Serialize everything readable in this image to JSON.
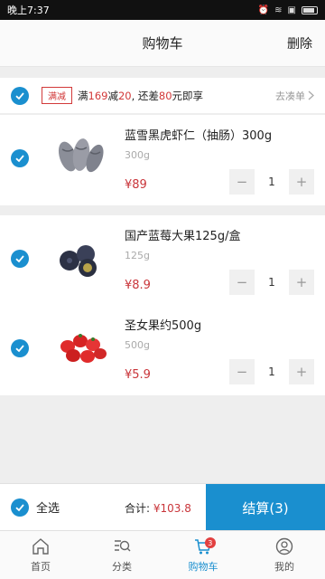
{
  "status_bar": {
    "time": "晚上7:37"
  },
  "header": {
    "title": "购物车",
    "delete_label": "删除"
  },
  "promo": {
    "tag": "满减",
    "text_prefix": "满",
    "threshold": "169",
    "text_mid1": "减",
    "discount": "20",
    "text_mid2": ", 还差",
    "remaining": "80",
    "text_suffix": "元即享",
    "more_label": "去凑单"
  },
  "items": [
    {
      "name": "蓝雪黑虎虾仁（抽肠）300g",
      "weight": "300g",
      "price": "¥89",
      "qty": "1"
    },
    {
      "name": "国产蓝莓大果125g/盒",
      "weight": "125g",
      "price": "¥8.9",
      "qty": "1"
    },
    {
      "name": "圣女果约500g",
      "weight": "500g",
      "price": "¥5.9",
      "qty": "1"
    }
  ],
  "bottom_bar": {
    "select_all_label": "全选",
    "total_label": "合计:",
    "total_amount": "¥103.8",
    "checkout_label": "结算(3)"
  },
  "tabs": [
    {
      "label": "首页",
      "icon": "home-icon"
    },
    {
      "label": "分类",
      "icon": "category-search-icon"
    },
    {
      "label": "购物车",
      "icon": "cart-icon",
      "badge": "3",
      "active": true
    },
    {
      "label": "我的",
      "icon": "profile-icon"
    }
  ],
  "colors": {
    "accent": "#1a8fcf",
    "price": "#c9353a",
    "promo_red": "#d23a3a"
  }
}
